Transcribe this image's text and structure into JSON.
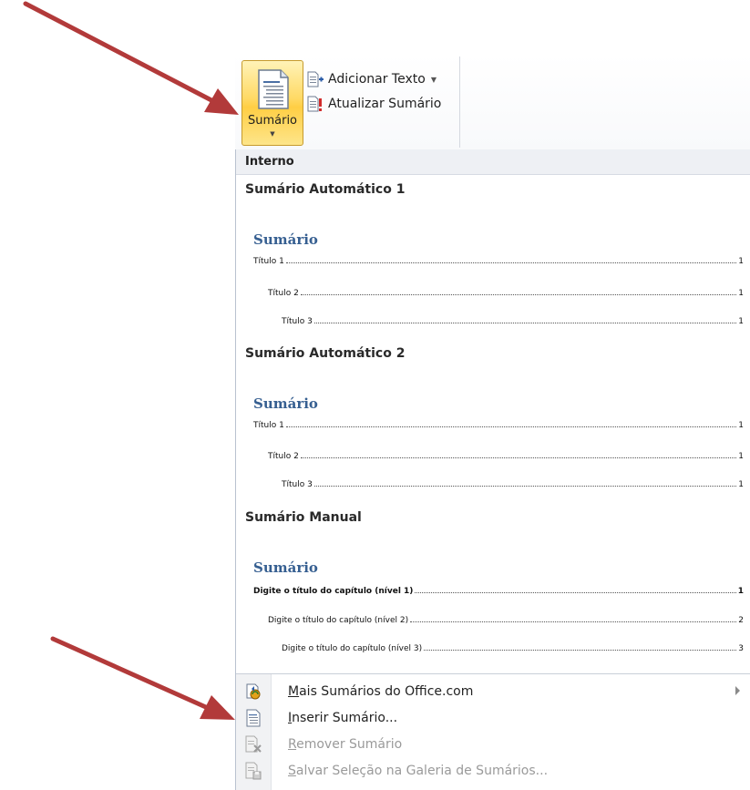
{
  "ribbon": {
    "big_button_label": "Sumário",
    "add_text_label": "Adicionar Texto",
    "update_toc_label": "Atualizar Sumário"
  },
  "menu": {
    "heading": "Interno",
    "items": [
      {
        "name": "Sumário Automático 1",
        "preview_title": "Sumário",
        "lines": [
          {
            "text": "Título 1",
            "page": "1"
          },
          {
            "text": "Título 2",
            "page": "1"
          },
          {
            "text": "Título 3",
            "page": "1"
          }
        ]
      },
      {
        "name": "Sumário Automático 2",
        "preview_title": "Sumário",
        "lines": [
          {
            "text": "Título 1",
            "page": "1"
          },
          {
            "text": "Título 2",
            "page": "1"
          },
          {
            "text": "Título 3",
            "page": "1"
          }
        ]
      },
      {
        "name": "Sumário Manual",
        "preview_title": "Sumário",
        "lines": [
          {
            "text": "Digite o título do capítulo (nível 1)",
            "page": "1"
          },
          {
            "text": "Digite o título do capítulo (nível 2)",
            "page": "2"
          },
          {
            "text": "Digite o título do capítulo (nível 3)",
            "page": "3"
          }
        ]
      }
    ],
    "commands": [
      {
        "label_first": "M",
        "label_rest": "ais Sumários do Office.com",
        "icon": "office-online-icon",
        "enabled": true,
        "submenu": true
      },
      {
        "label_first": "I",
        "label_rest": "nserir Sumário...",
        "icon": "insert-toc-icon",
        "enabled": true,
        "submenu": false
      },
      {
        "label_first": "R",
        "label_rest": "emover Sumário",
        "icon": "remove-toc-icon",
        "enabled": false,
        "submenu": false
      },
      {
        "label_first": "S",
        "label_rest": "alvar Seleção na Galeria de Sumários...",
        "icon": "save-gallery-icon",
        "enabled": false,
        "submenu": false
      }
    ]
  },
  "colors": {
    "accent_yellow": "#ffd964",
    "preview_title_blue": "#365f91",
    "annotation_red": "#b23a3a"
  }
}
